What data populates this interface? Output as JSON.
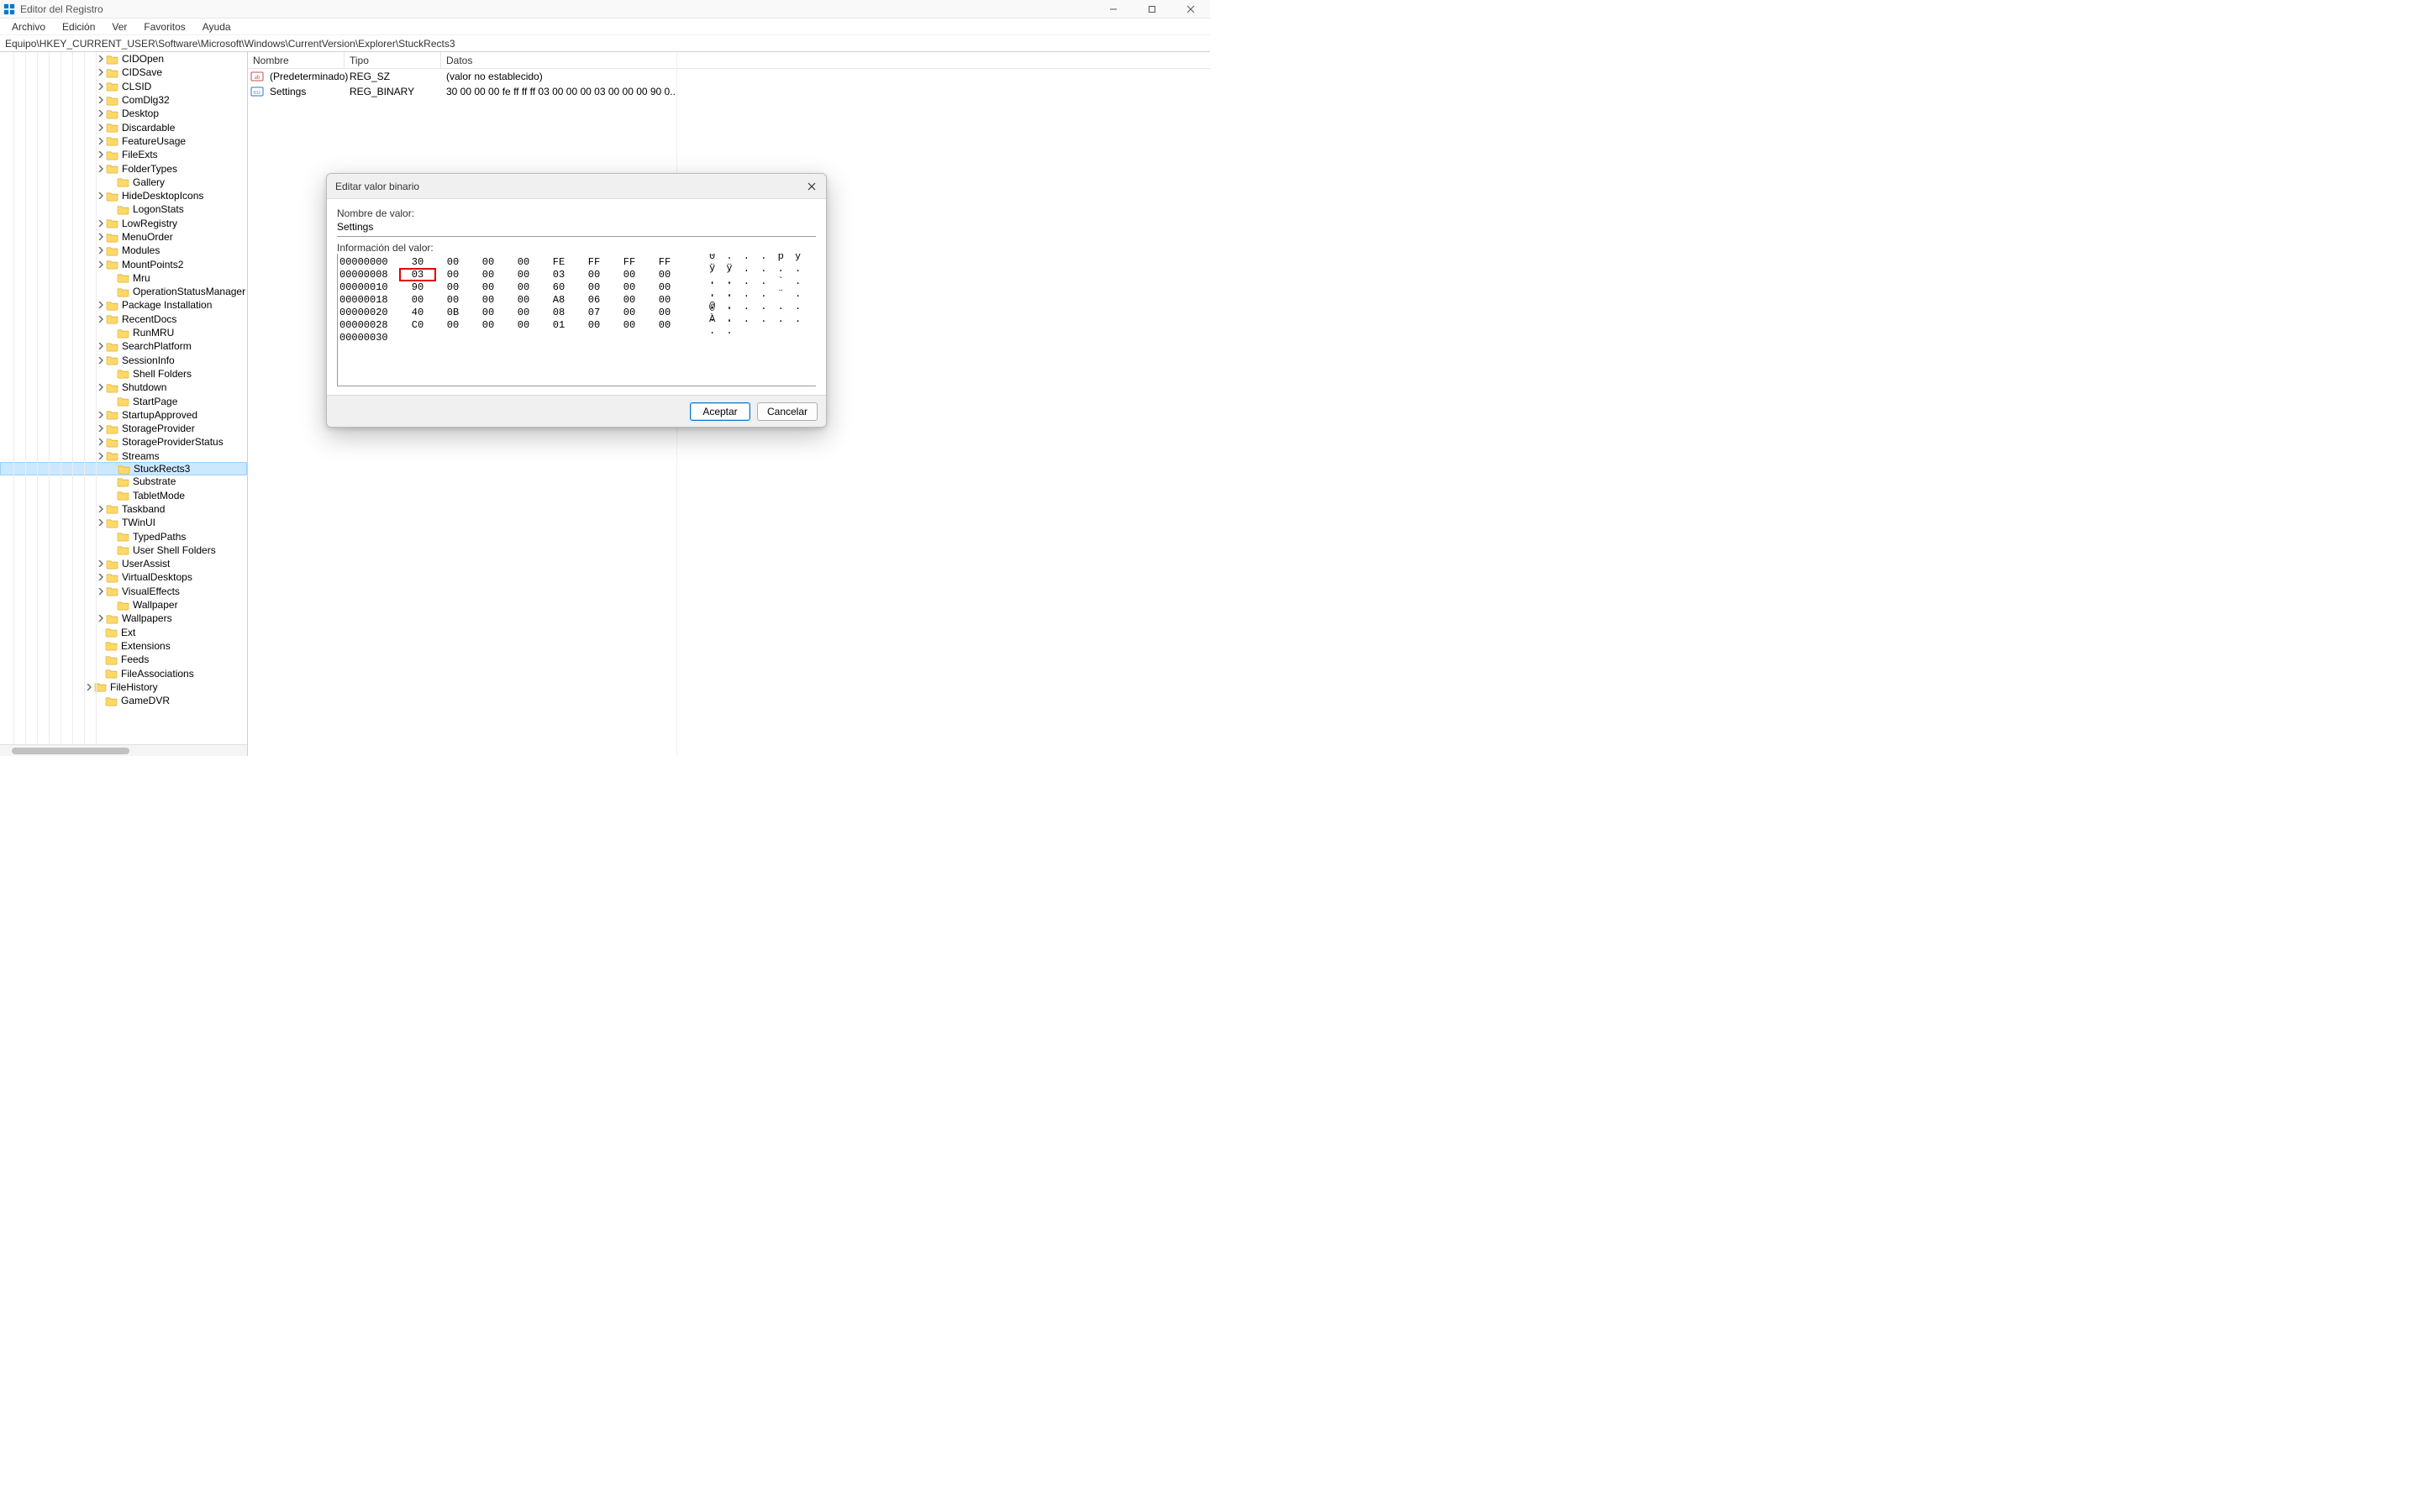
{
  "window": {
    "title": "Editor del Registro"
  },
  "menu": {
    "items": [
      "Archivo",
      "Edición",
      "Ver",
      "Favoritos",
      "Ayuda"
    ]
  },
  "address": "Equipo\\HKEY_CURRENT_USER\\Software\\Microsoft\\Windows\\CurrentVersion\\Explorer\\StuckRects3",
  "tree": {
    "indent": 126,
    "items": [
      {
        "label": "CIDOpen",
        "expandable": true
      },
      {
        "label": "CIDSave",
        "expandable": true
      },
      {
        "label": "CLSID",
        "expandable": true
      },
      {
        "label": "ComDlg32",
        "expandable": true
      },
      {
        "label": "Desktop",
        "expandable": true
      },
      {
        "label": "Discardable",
        "expandable": true
      },
      {
        "label": "FeatureUsage",
        "expandable": true
      },
      {
        "label": "FileExts",
        "expandable": true
      },
      {
        "label": "FolderTypes",
        "expandable": true
      },
      {
        "label": "Gallery",
        "expandable": false
      },
      {
        "label": "HideDesktopIcons",
        "expandable": true
      },
      {
        "label": "LogonStats",
        "expandable": false
      },
      {
        "label": "LowRegistry",
        "expandable": true
      },
      {
        "label": "MenuOrder",
        "expandable": true
      },
      {
        "label": "Modules",
        "expandable": true
      },
      {
        "label": "MountPoints2",
        "expandable": true
      },
      {
        "label": "Mru",
        "expandable": false
      },
      {
        "label": "OperationStatusManager",
        "expandable": false
      },
      {
        "label": "Package Installation",
        "expandable": true
      },
      {
        "label": "RecentDocs",
        "expandable": true
      },
      {
        "label": "RunMRU",
        "expandable": false
      },
      {
        "label": "SearchPlatform",
        "expandable": true
      },
      {
        "label": "SessionInfo",
        "expandable": true
      },
      {
        "label": "Shell Folders",
        "expandable": false
      },
      {
        "label": "Shutdown",
        "expandable": true
      },
      {
        "label": "StartPage",
        "expandable": false
      },
      {
        "label": "StartupApproved",
        "expandable": true
      },
      {
        "label": "StorageProvider",
        "expandable": true
      },
      {
        "label": "StorageProviderStatus",
        "expandable": true
      },
      {
        "label": "Streams",
        "expandable": true
      },
      {
        "label": "StuckRects3",
        "expandable": false,
        "selected": true
      },
      {
        "label": "Substrate",
        "expandable": false
      },
      {
        "label": "TabletMode",
        "expandable": false
      },
      {
        "label": "Taskband",
        "expandable": true
      },
      {
        "label": "TWinUI",
        "expandable": true
      },
      {
        "label": "TypedPaths",
        "expandable": false
      },
      {
        "label": "User Shell Folders",
        "expandable": false
      },
      {
        "label": "UserAssist",
        "expandable": true
      },
      {
        "label": "VirtualDesktops",
        "expandable": true
      },
      {
        "label": "VisualEffects",
        "expandable": true
      },
      {
        "label": "Wallpaper",
        "expandable": false
      },
      {
        "label": "Wallpapers",
        "expandable": true
      }
    ],
    "tail_indent": 112,
    "tail_items": [
      {
        "label": "Ext",
        "expandable": false
      },
      {
        "label": "Extensions",
        "expandable": false
      },
      {
        "label": "Feeds",
        "expandable": false
      },
      {
        "label": "FileAssociations",
        "expandable": false
      },
      {
        "label": "FileHistory",
        "expandable": true
      },
      {
        "label": "GameDVR",
        "expandable": false
      }
    ]
  },
  "columns": {
    "name": "Nombre",
    "type": "Tipo",
    "data": "Datos"
  },
  "values": [
    {
      "icon": "sz",
      "name": "(Predeterminado)",
      "type": "REG_SZ",
      "data": "(valor no establecido)"
    },
    {
      "icon": "bin",
      "name": "Settings",
      "type": "REG_BINARY",
      "data": "30 00 00 00 fe ff ff ff 03 00 00 00 03 00 00 00 90 0..."
    }
  ],
  "dialog": {
    "title": "Editar valor binario",
    "name_label": "Nombre de valor:",
    "value_name": "Settings",
    "data_label": "Información del valor:",
    "rows": [
      {
        "off": "00000000",
        "b": [
          "30",
          "00",
          "00",
          "00",
          "FE",
          "FF",
          "FF",
          "FF"
        ],
        "a": "0 . . . þ ÿ ÿ ÿ"
      },
      {
        "off": "00000008",
        "b": [
          "03",
          "00",
          "00",
          "00",
          "03",
          "00",
          "00",
          "00"
        ],
        "a": ". . . . . . . ."
      },
      {
        "off": "00000010",
        "b": [
          "90",
          "00",
          "00",
          "00",
          "60",
          "00",
          "00",
          "00"
        ],
        "a": ". . . . ` . . ."
      },
      {
        "off": "00000018",
        "b": [
          "00",
          "00",
          "00",
          "00",
          "A8",
          "06",
          "00",
          "00"
        ],
        "a": ". . . . ¨ . . ."
      },
      {
        "off": "00000020",
        "b": [
          "40",
          "0B",
          "00",
          "00",
          "08",
          "07",
          "00",
          "00"
        ],
        "a": "@ . . . . . . ."
      },
      {
        "off": "00000028",
        "b": [
          "C0",
          "00",
          "00",
          "00",
          "01",
          "00",
          "00",
          "00"
        ],
        "a": "À . . . . . . ."
      },
      {
        "off": "00000030",
        "b": [],
        "a": ""
      }
    ],
    "highlight": {
      "row": 1,
      "col": 0
    },
    "ok": "Aceptar",
    "cancel": "Cancelar"
  }
}
